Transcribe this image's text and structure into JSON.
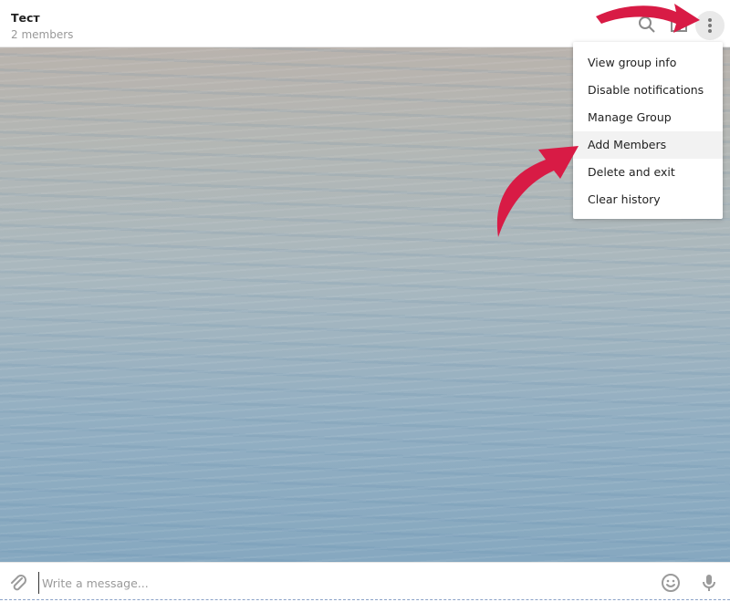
{
  "header": {
    "title": "Тест",
    "subtitle": "2 members"
  },
  "menu": {
    "items": [
      {
        "label": "View group info"
      },
      {
        "label": "Disable notifications"
      },
      {
        "label": "Manage Group"
      },
      {
        "label": "Add Members"
      },
      {
        "label": "Delete and exit"
      },
      {
        "label": "Clear history"
      }
    ],
    "highlighted_index": 3
  },
  "composer": {
    "placeholder": "Write a message..."
  },
  "icons": {
    "search": "search-icon",
    "info_panel": "sidebar-icon",
    "more": "more-vertical-icon",
    "attach": "paperclip-icon",
    "emoji": "smiley-icon",
    "microphone": "microphone-icon"
  },
  "colors": {
    "annotation_arrow": "#d81b45",
    "menu_hover": "#f2f2f2"
  }
}
